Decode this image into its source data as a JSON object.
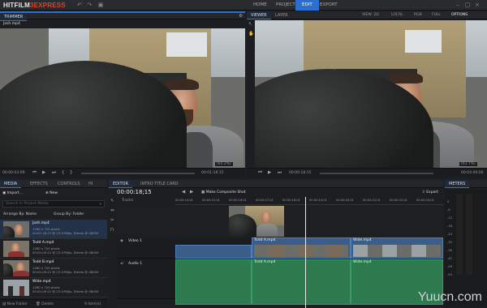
{
  "app": {
    "logo_main": "HITFILM",
    "logo_num": "3",
    "logo_express": "EXPRESS"
  },
  "workspaces": [
    "HOME",
    "PROJECT",
    "EDIT",
    "EXPORT"
  ],
  "trimmer": {
    "tab": "TRIMMER",
    "file": "Josh.mp4",
    "timecode_in": "00:00:03:09",
    "timecode_out": "00:01:18:15",
    "zoom": "(65.2%)"
  },
  "viewer": {
    "tabs": [
      "VIEWER",
      "LAYER"
    ],
    "view_label": "VIEW: 2D",
    "local_label": "LOCAL",
    "rgb_label": "RGB",
    "full_label": "FULL",
    "options_label": "OPTIONS",
    "timecode_in": "00:00:18:15",
    "timecode_out": "00:04:09:00",
    "zoom": "(61.7%)"
  },
  "media_panel": {
    "tabs": [
      "MEDIA",
      "EFFECTS",
      "CONTROLS",
      "HI"
    ],
    "import_label": "Import...",
    "new_label": "New",
    "search_placeholder": "Search in Project Media",
    "arrange_label": "Arrange By: Name",
    "group_label": "Group By: Folder",
    "items": [
      {
        "name": "Josh.mp4",
        "info1": "1280 x 720 pixels",
        "info2": "00:01:18:15 @ 23.976fps, Stereo @ 48000"
      },
      {
        "name": "Todd A.mp4",
        "info1": "1280 x 720 pixels",
        "info2": "00:01:05:21 @ 23.976fps, Stereo @ 48000"
      },
      {
        "name": "Todd B.mp4",
        "info1": "1280 x 720 pixels",
        "info2": "00:01:05:21 @ 23.976fps, Stereo @ 48000"
      },
      {
        "name": "Wide.mp4",
        "info1": "1280 x 720 pixels",
        "info2": "00:01:05:21 @ 23.976fps, Stereo @ 48000"
      }
    ],
    "new_folder_label": "New Folder",
    "delete_label": "Delete",
    "count_label": "9 item(s)"
  },
  "editor": {
    "tabs": [
      "EDITOR",
      "INTRO TITLE CARD"
    ],
    "timecode": "00:00:18;15",
    "tracks_label": "Tracks",
    "make_composite_label": "Make Composite Shot",
    "export_label": "Export",
    "ruler": [
      "00:00:14;01",
      "00:00:15;01",
      "00:00:16;01",
      "00:00:17;01",
      "00:00:18;01",
      "00:00:19;01",
      "00:00:20;01",
      "00:00:21;01",
      "00:00:22;01",
      "00:00:23;01"
    ],
    "video_track": "Video 1",
    "audio_track": "Audio 1",
    "clips": [
      {
        "label": "Todd A.mp4"
      },
      {
        "label": "Wide.mp4"
      }
    ],
    "audio_clips": [
      {
        "label": "Todd A.mp4"
      },
      {
        "label": "Wide.mp4"
      }
    ]
  },
  "meters": {
    "tab": "METERS",
    "scale": [
      "0",
      "-6",
      "-12",
      "-18",
      "-24",
      "-30",
      "-36",
      "-42",
      "-48",
      "-54"
    ]
  },
  "watermark": "Yuucn.com",
  "colors": {
    "accent": "#2c6fcf",
    "video_clip": "#3a5d8a",
    "audio_clip": "#2d7a4f"
  }
}
